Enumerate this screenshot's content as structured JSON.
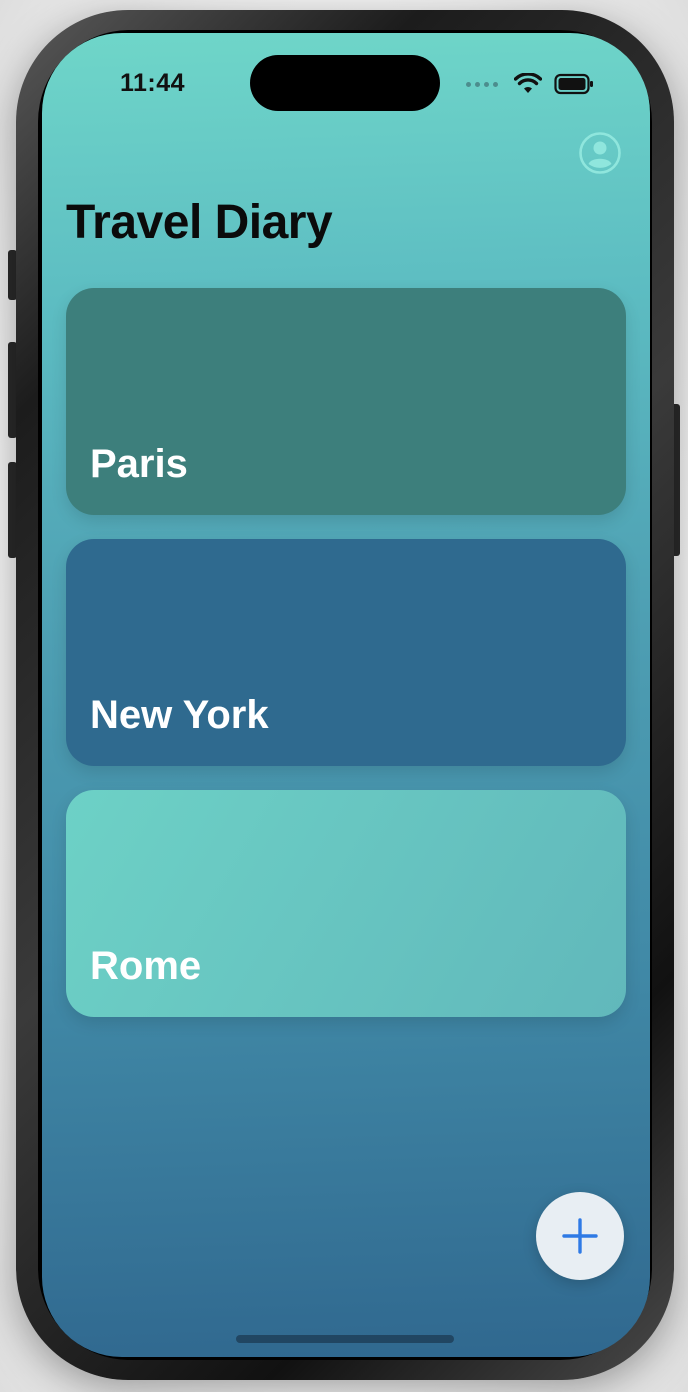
{
  "status_bar": {
    "time": "11:44"
  },
  "header": {
    "title": "Travel Diary"
  },
  "cards": [
    {
      "label": "Paris",
      "color": "#3d7f7c"
    },
    {
      "label": "New York",
      "color": "#2f6a8f"
    },
    {
      "label": "Rome",
      "color": "#6dd1c6",
      "color_end": "#61b8bb"
    }
  ],
  "icons": {
    "profile": "person-circle-icon",
    "add": "plus-icon",
    "wifi": "wifi-icon",
    "battery": "battery-icon",
    "signal": "cellular-signal-icon"
  },
  "colors": {
    "accent": "#2f7ae5",
    "bg_top": "#6fd6c9",
    "bg_bottom": "#30688f"
  }
}
